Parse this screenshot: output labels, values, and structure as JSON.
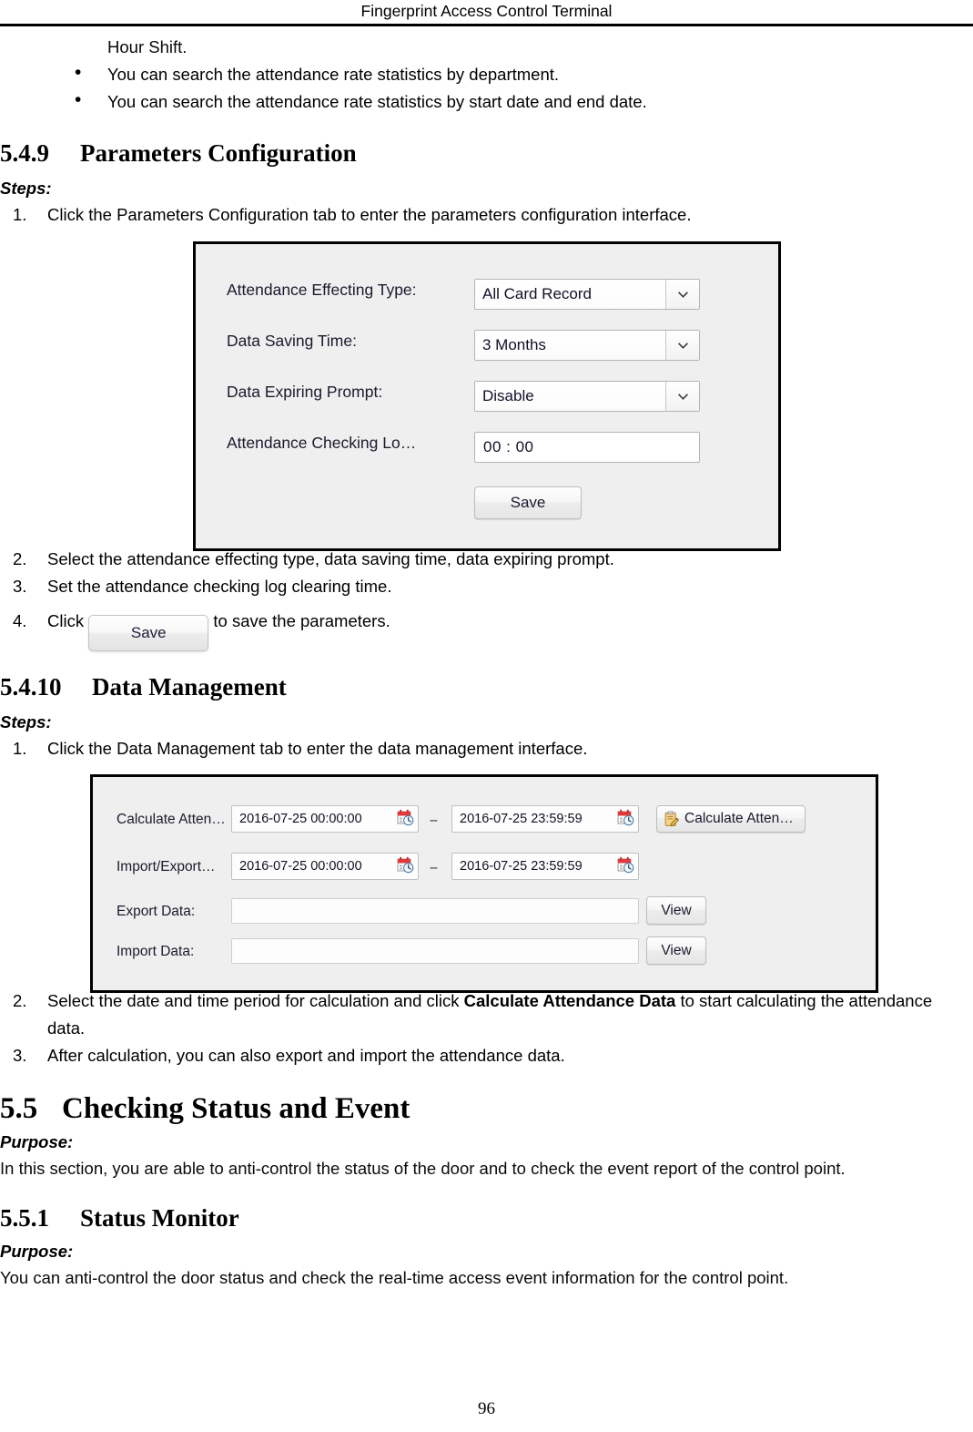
{
  "header": {
    "title": "Fingerprint Access Control Terminal"
  },
  "intro": {
    "trailing_line": "Hour Shift.",
    "bullets": [
      "You can search the attendance rate statistics by department.",
      "You can search the attendance rate statistics by start date and end date."
    ],
    "bullet_glyph": "•"
  },
  "section_549": {
    "number": "5.4.9",
    "title": "Parameters Configuration",
    "steps_label": "Steps:",
    "step1": {
      "num": "1.",
      "text": "Click the Parameters Configuration tab to enter the parameters configuration interface."
    },
    "step2": {
      "num": "2.",
      "text": "Select the attendance effecting type, data saving time, data expiring prompt."
    },
    "step3": {
      "num": "3.",
      "text": "Set the attendance checking log clearing time."
    },
    "step4": {
      "num": "4.",
      "prefix": "Click",
      "button_label": "Save",
      "suffix": "to save the parameters."
    }
  },
  "params_dialog": {
    "rows": [
      {
        "label": "Attendance Effecting Type:",
        "value": "All Card Record",
        "control": "combobox"
      },
      {
        "label": "Data Saving Time:",
        "value": "3 Months",
        "control": "combobox"
      },
      {
        "label": "Data Expiring Prompt:",
        "value": "Disable",
        "control": "combobox"
      },
      {
        "label": "Attendance Checking Lo…",
        "value": "00 : 00",
        "control": "textbox"
      }
    ],
    "save_button": "Save"
  },
  "section_5410": {
    "number": "5.4.10",
    "title": "Data Management",
    "steps_label": "Steps:",
    "step1": {
      "num": "1.",
      "text": "Click the Data Management tab to enter the data management interface."
    },
    "step2": {
      "num": "2.",
      "text_before": "Select the date and time period for calculation and click ",
      "bold_run": "Calculate Attendance Data",
      "text_after": " to start calculating the attendance data."
    },
    "step3": {
      "num": "3.",
      "text": "After calculation, you can also export and import the attendance data."
    }
  },
  "data_dialog": {
    "rows": [
      {
        "label": "Calculate Atten…",
        "start": "2016-07-25 00:00:00",
        "separator": "--",
        "end": "2016-07-25 23:59:59",
        "action_label": "Calculate Atten…",
        "action_icon": "clipboard-pencil-icon"
      },
      {
        "label": "Import/Export…",
        "start": "2016-07-25 00:00:00",
        "separator": "--",
        "end": "2016-07-25 23:59:59"
      },
      {
        "label": "Export Data:",
        "value": "",
        "action_label": "View"
      },
      {
        "label": "Import Data:",
        "value": "",
        "action_label": "View"
      }
    ],
    "calendar_icon": "calendar-clock-icon"
  },
  "section_55": {
    "number": "5.5",
    "title": "Checking Status and Event",
    "purpose_label": "Purpose:",
    "purpose_text": "In this section, you are able to anti-control the status of the door and to check the event report of the control point."
  },
  "section_551": {
    "number": "5.5.1",
    "title": "Status Monitor",
    "purpose_label": "Purpose:",
    "purpose_text": "You can anti-control the door status and check the real-time access event information for the control point."
  },
  "footer": {
    "page_number": "96"
  },
  "colors": {
    "panel_bg": "#efefef",
    "panel_border": "#000000",
    "calendar_red": "#e03a3a",
    "clipboard_yellow": "#e8a33d",
    "text": "#0a0a0a"
  }
}
